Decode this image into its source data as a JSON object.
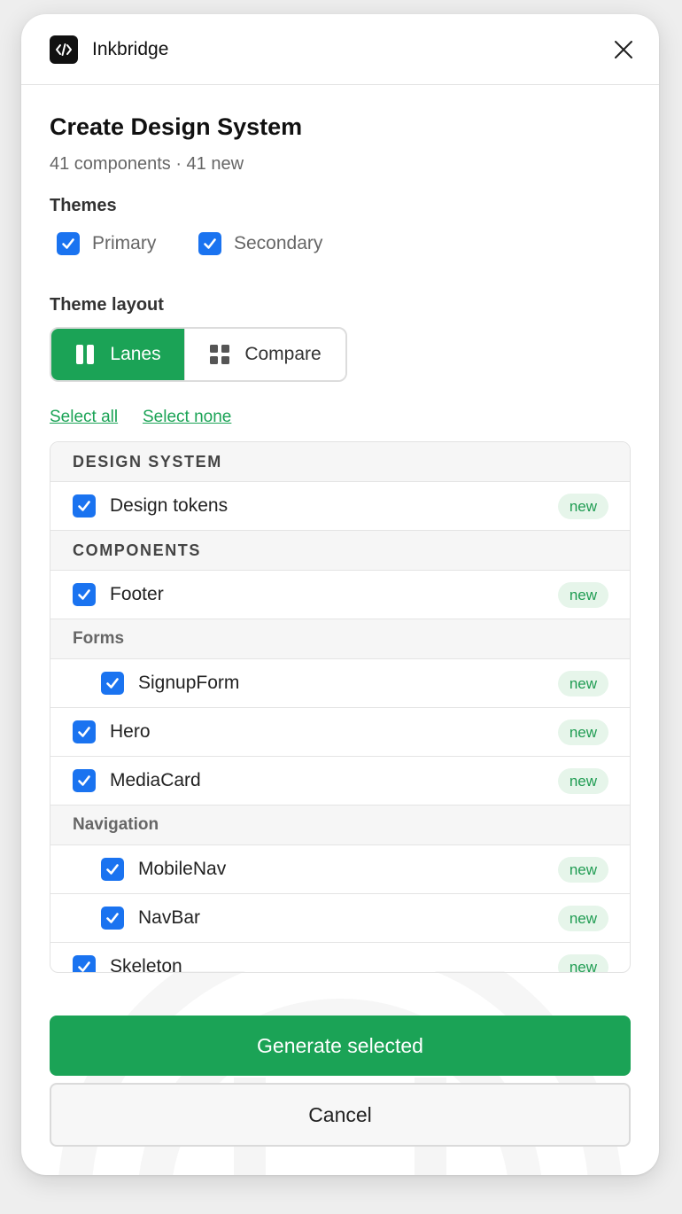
{
  "app": {
    "name": "Inkbridge",
    "logo_icon": "code-brackets-icon"
  },
  "dialog": {
    "title": "Create Design System",
    "subtitle": "41 components · 41 new"
  },
  "themes": {
    "label": "Themes",
    "options": [
      {
        "label": "Primary",
        "checked": true
      },
      {
        "label": "Secondary",
        "checked": true
      }
    ]
  },
  "theme_layout": {
    "label": "Theme layout",
    "selected": "Lanes",
    "options": [
      {
        "label": "Lanes",
        "icon": "columns-icon",
        "active": true
      },
      {
        "label": "Compare",
        "icon": "grid-icon",
        "active": false
      }
    ]
  },
  "selection": {
    "select_all": "Select all",
    "select_none": "Select none"
  },
  "list": {
    "rows": [
      {
        "kind": "category",
        "label": "DESIGN SYSTEM"
      },
      {
        "kind": "item",
        "label": "Design tokens",
        "badge": "new",
        "checked": true,
        "nested": false
      },
      {
        "kind": "category",
        "label": "COMPONENTS"
      },
      {
        "kind": "item",
        "label": "Footer",
        "badge": "new",
        "checked": true,
        "nested": false
      },
      {
        "kind": "group",
        "label": "Forms"
      },
      {
        "kind": "item",
        "label": "SignupForm",
        "badge": "new",
        "checked": true,
        "nested": true
      },
      {
        "kind": "item",
        "label": "Hero",
        "badge": "new",
        "checked": true,
        "nested": false
      },
      {
        "kind": "item",
        "label": "MediaCard",
        "badge": "new",
        "checked": true,
        "nested": false
      },
      {
        "kind": "group",
        "label": "Navigation"
      },
      {
        "kind": "item",
        "label": "MobileNav",
        "badge": "new",
        "checked": true,
        "nested": true
      },
      {
        "kind": "item",
        "label": "NavBar",
        "badge": "new",
        "checked": true,
        "nested": true
      },
      {
        "kind": "item",
        "label": "Skeleton",
        "badge": "new",
        "checked": true,
        "nested": false
      }
    ]
  },
  "actions": {
    "primary": "Generate selected",
    "secondary": "Cancel"
  },
  "colors": {
    "accent": "#1ba356",
    "checkbox": "#1a73f0",
    "badge_bg": "#e6f5ea",
    "badge_text": "#1f9c52"
  }
}
